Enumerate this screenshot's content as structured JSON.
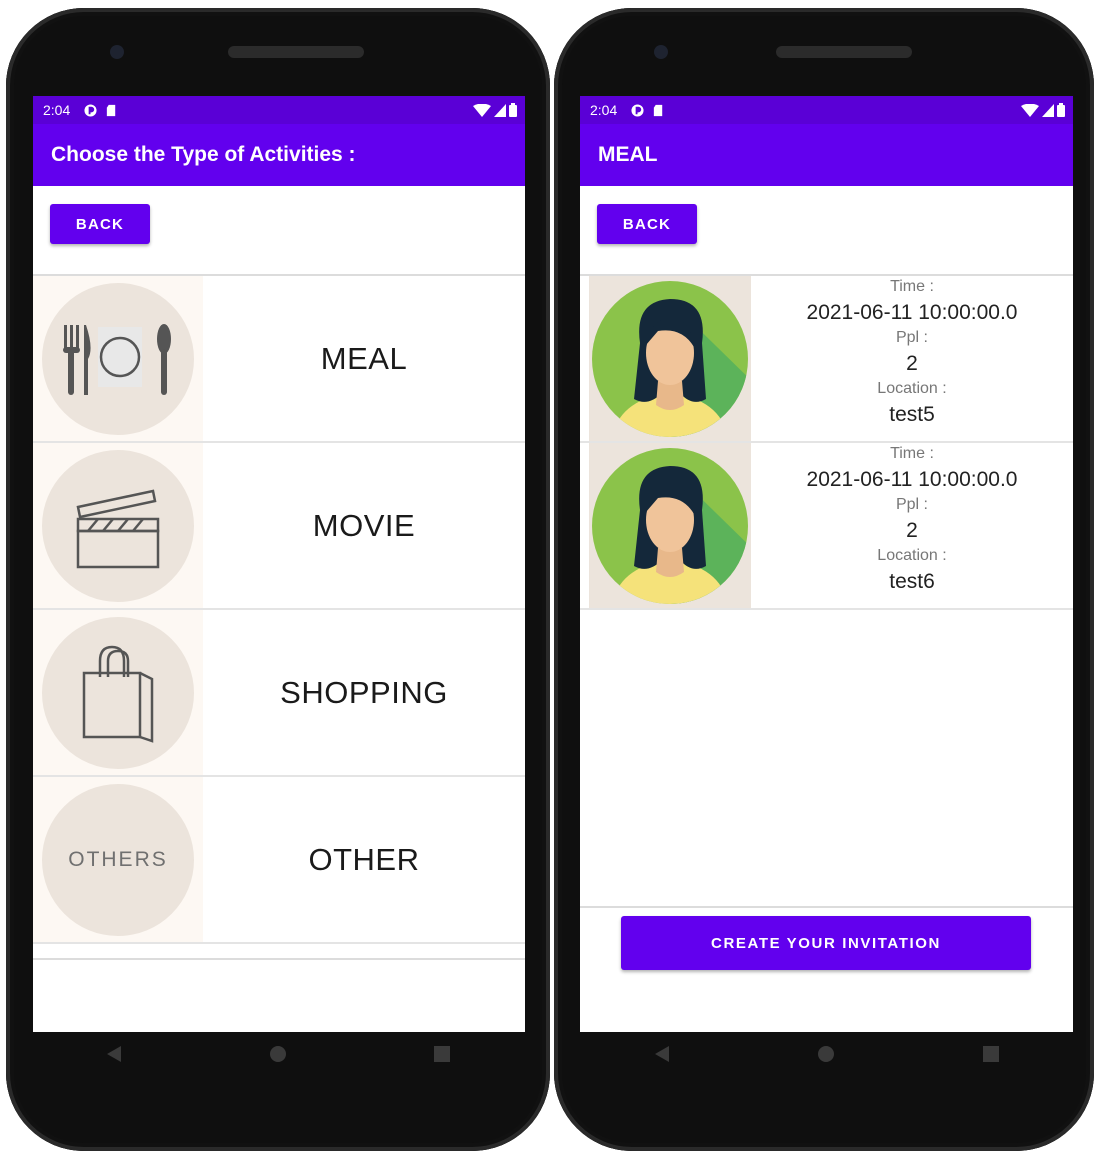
{
  "left": {
    "status": {
      "time": "2:04"
    },
    "appbar": {
      "title": "Choose the Type of Activities :"
    },
    "back_label": "BACK",
    "activities": [
      {
        "label": "MEAL",
        "icon": "meal-icon"
      },
      {
        "label": "MOVIE",
        "icon": "clapperboard-icon"
      },
      {
        "label": "SHOPPING",
        "icon": "shopping-bag-icon"
      },
      {
        "label": "OTHER",
        "icon": "others-icon",
        "icon_text": "OTHERS"
      }
    ]
  },
  "right": {
    "status": {
      "time": "2:04"
    },
    "appbar": {
      "title": "MEAL"
    },
    "back_label": "BACK",
    "invitations": [
      {
        "time_label": "Time :",
        "time": "2021-06-11 10:00:00.0",
        "ppl_label": "Ppl :",
        "ppl": "2",
        "location_label": "Location :",
        "location": "test5"
      },
      {
        "time_label": "Time :",
        "time": "2021-06-11 10:00:00.0",
        "ppl_label": "Ppl :",
        "ppl": "2",
        "location_label": "Location :",
        "location": "test6"
      }
    ],
    "create_label": "CREATE YOUR INVITATION"
  },
  "colors": {
    "primary": "#6200ee",
    "status_bar": "#5a00d6"
  }
}
